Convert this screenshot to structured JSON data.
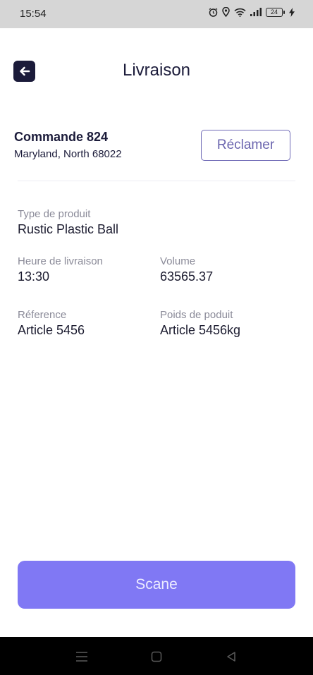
{
  "status_bar": {
    "time": "15:54",
    "battery": "24"
  },
  "header": {
    "title": "Livraison",
    "back_icon": "arrow-left-icon"
  },
  "order": {
    "title": "Commande 824",
    "address": "Maryland, North 68022",
    "claim_label": "Réclamer"
  },
  "details": {
    "product_type_label": "Type de produit",
    "product_type_value": "Rustic Plastic Ball",
    "delivery_time_label": "Heure de livraison",
    "delivery_time_value": "13:30",
    "volume_label": "Volume",
    "volume_value": "63565.37",
    "reference_label": "Réference",
    "reference_value": "Article 5456",
    "weight_label": "Poids de poduit",
    "weight_value": "Article 5456kg"
  },
  "actions": {
    "scan_label": "Scane"
  },
  "colors": {
    "accent": "#8078f4",
    "dark": "#1b1b3a",
    "outline": "#6f6ab6"
  }
}
